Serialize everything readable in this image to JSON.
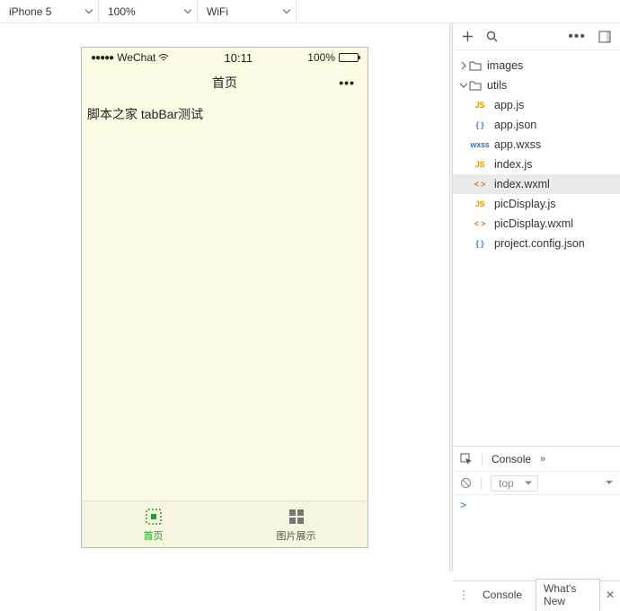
{
  "toolbar": {
    "device": "iPhone 5",
    "zoom": "100%",
    "network": "WiFi"
  },
  "simulator": {
    "carrier": "WeChat",
    "time": "10:11",
    "battery_pct": "100%",
    "nav_title": "首页",
    "body_text": "脚本之家 tabBar测试",
    "tabs": [
      {
        "label": "首页",
        "active": true
      },
      {
        "label": "图片展示",
        "active": false
      }
    ]
  },
  "file_tree": {
    "folders": [
      {
        "name": "images",
        "expanded": false
      },
      {
        "name": "utils",
        "expanded": true
      }
    ],
    "files": [
      {
        "name": "app.js",
        "type": "js",
        "selected": false
      },
      {
        "name": "app.json",
        "type": "json",
        "selected": false
      },
      {
        "name": "app.wxss",
        "type": "wxss",
        "selected": false
      },
      {
        "name": "index.js",
        "type": "js",
        "selected": false
      },
      {
        "name": "index.wxml",
        "type": "wxml",
        "selected": true
      },
      {
        "name": "picDisplay.js",
        "type": "js",
        "selected": false
      },
      {
        "name": "picDisplay.wxml",
        "type": "wxml",
        "selected": false
      },
      {
        "name": "project.config.json",
        "type": "json",
        "selected": false
      }
    ],
    "type_labels": {
      "js": "JS",
      "json": "{ }",
      "wxss": "wxss",
      "wxml": "< >"
    }
  },
  "devtools": {
    "tab_label": "Console",
    "scope_label": "top",
    "prompt": ">"
  },
  "bottom_tabs": {
    "console": "Console",
    "whats_new": "What's New"
  }
}
